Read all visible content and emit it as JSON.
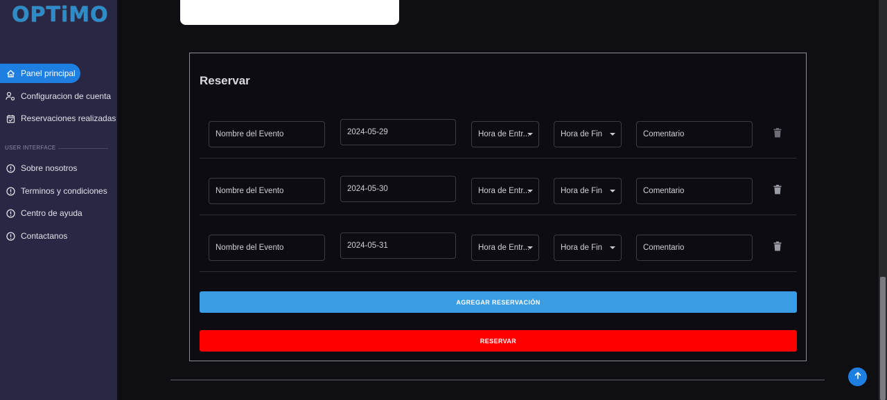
{
  "app": {
    "logo": "OPTiMO"
  },
  "sidebar": {
    "items": [
      {
        "label": "Panel principal",
        "icon": "home-icon",
        "active": true
      },
      {
        "label": "Configuracion de cuenta",
        "icon": "user-settings-icon"
      },
      {
        "label": "Reservaciones realizadas",
        "icon": "calendar-check-icon"
      }
    ],
    "section_title": "USER INTERFACE",
    "info_items": [
      {
        "label": "Sobre nosotros",
        "icon": "info-icon"
      },
      {
        "label": "Terminos y condiciones",
        "icon": "info-icon"
      },
      {
        "label": "Centro de ayuda",
        "icon": "info-icon"
      },
      {
        "label": "Contactanos",
        "icon": "info-icon"
      }
    ]
  },
  "panel": {
    "title": "Reservar",
    "rows": [
      {
        "event_placeholder": "Nombre del Evento",
        "date": "2024-05-29",
        "start_placeholder": "Hora de Entr...",
        "end_placeholder": "Hora de Fin",
        "comment_placeholder": "Comentario"
      },
      {
        "event_placeholder": "Nombre del Evento",
        "date": "2024-05-30",
        "start_placeholder": "Hora de Entr...",
        "end_placeholder": "Hora de Fin",
        "comment_placeholder": "Comentario"
      },
      {
        "event_placeholder": "Nombre del Evento",
        "date": "2024-05-31",
        "start_placeholder": "Hora de Entr...",
        "end_placeholder": "Hora de Fin",
        "comment_placeholder": "Comentario"
      }
    ],
    "add_button": "AGREGAR RESERVACIÓN",
    "reserve_button": "RESERVAR"
  },
  "colors": {
    "accent": "#1f7fe0",
    "add": "#3a9de3",
    "reserve": "#ff0000",
    "sidebar": "#2a2744"
  }
}
